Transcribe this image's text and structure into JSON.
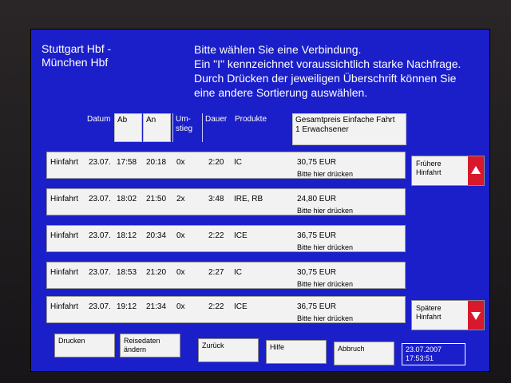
{
  "route": {
    "line1": "Stuttgart Hbf -",
    "line2": "München Hbf"
  },
  "instructions": {
    "line1": "Bitte wählen Sie eine Verbindung.",
    "line2": "Ein \"I\" kennzeichnet voraussichtlich starke Nachfrage.",
    "line3": "Durch Drücken der jeweiligen Überschrift können Sie",
    "line4": "eine andere Sortierung auswählen."
  },
  "headers": {
    "datum": "Datum",
    "ab": "Ab",
    "an": "An",
    "umstieg1": "Um-",
    "umstieg2": "stieg",
    "dauer": "Dauer",
    "produkte": "Produkte",
    "preis1": "Gesamtpreis Einfache Fahrt",
    "preis2": "1 Erwachsener"
  },
  "rows": [
    {
      "type": "Hinfahrt",
      "date": "23.07.",
      "ab": "17:58",
      "an": "20:18",
      "umstieg": "0x",
      "dauer": "2:20",
      "produkte": "IC",
      "price": "30,75 EUR",
      "hint": "Bitte hier drücken"
    },
    {
      "type": "Hinfahrt",
      "date": "23.07.",
      "ab": "18:02",
      "an": "21:50",
      "umstieg": "2x",
      "dauer": "3:48",
      "produkte": "IRE, RB",
      "price": "24,80 EUR",
      "hint": "Bitte hier drücken"
    },
    {
      "type": "Hinfahrt",
      "date": "23.07.",
      "ab": "18:12",
      "an": "20:34",
      "umstieg": "0x",
      "dauer": "2:22",
      "produkte": "ICE",
      "price": "36,75 EUR",
      "hint": "Bitte hier drücken"
    },
    {
      "type": "Hinfahrt",
      "date": "23.07.",
      "ab": "18:53",
      "an": "21:20",
      "umstieg": "0x",
      "dauer": "2:27",
      "produkte": "IC",
      "price": "30,75 EUR",
      "hint": "Bitte hier drücken"
    },
    {
      "type": "Hinfahrt",
      "date": "23.07.",
      "ab": "19:12",
      "an": "21:34",
      "umstieg": "0x",
      "dauer": "2:22",
      "produkte": "ICE",
      "price": "36,75 EUR",
      "hint": "Bitte hier drücken"
    }
  ],
  "side": {
    "earlier1": "Frühere",
    "earlier2": "Hinfahrt",
    "later1": "Spätere",
    "later2": "Hinfahrt"
  },
  "footer": {
    "drucken": "Drucken",
    "reisedaten1": "Reisedaten",
    "reisedaten2": "ändern",
    "zurueck": "Zurück",
    "hilfe": "Hilfe",
    "abbruch": "Abbruch"
  },
  "clock": {
    "date": "23.07.2007",
    "time": "17:53:51"
  },
  "colors": {
    "screen": "#1b1fc9",
    "button": "#f2f2f2",
    "arrow": "#d8192b"
  }
}
